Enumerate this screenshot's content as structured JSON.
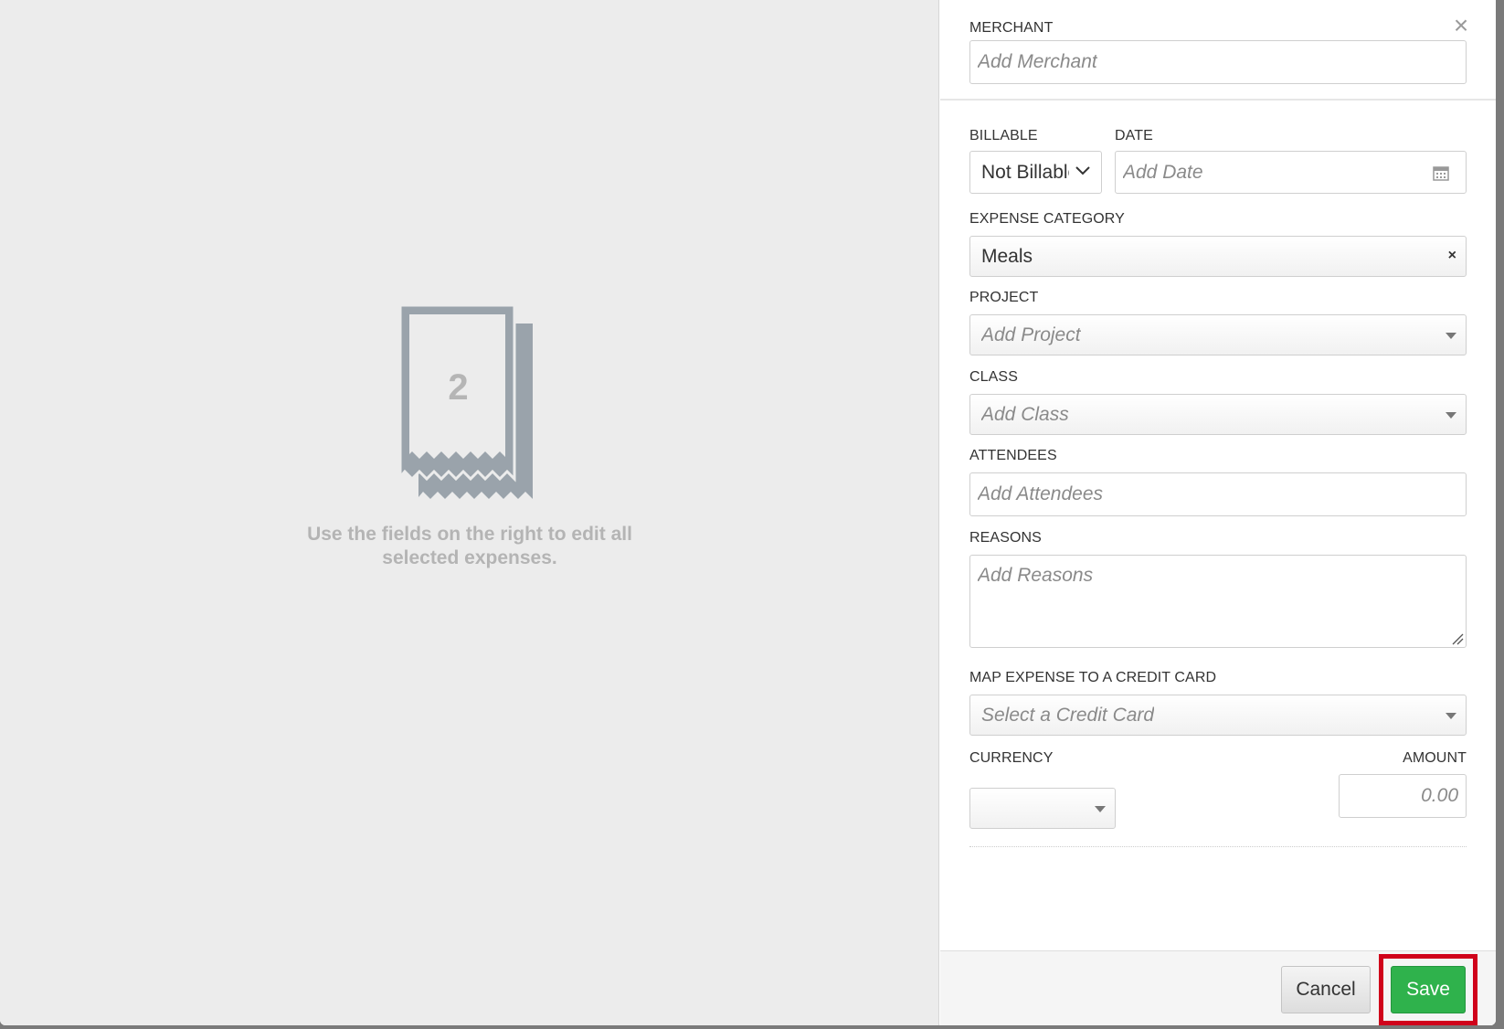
{
  "left": {
    "receipt_count": "2",
    "message": "Use the fields on the right to edit all selected expenses."
  },
  "form": {
    "merchant": {
      "label": "MERCHANT",
      "placeholder": "Add Merchant"
    },
    "billable": {
      "label": "BILLABLE",
      "value": "Not Billable"
    },
    "date": {
      "label": "DATE",
      "placeholder": "Add Date"
    },
    "expense_category": {
      "label": "EXPENSE CATEGORY",
      "value": "Meals"
    },
    "project": {
      "label": "PROJECT",
      "placeholder": "Add Project"
    },
    "class": {
      "label": "CLASS",
      "placeholder": "Add Class"
    },
    "attendees": {
      "label": "ATTENDEES",
      "placeholder": "Add Attendees"
    },
    "reasons": {
      "label": "REASONS",
      "placeholder": "Add Reasons"
    },
    "credit_card": {
      "label": "MAP EXPENSE TO A CREDIT CARD",
      "placeholder": "Select a Credit Card"
    },
    "currency": {
      "label": "CURRENCY",
      "value": ""
    },
    "amount": {
      "label": "AMOUNT",
      "placeholder": "0.00"
    }
  },
  "footer": {
    "cancel_label": "Cancel",
    "save_label": "Save"
  },
  "colors": {
    "save_green": "#2fb24c",
    "highlight_red": "#d0021b",
    "left_background": "#ececec",
    "receipt_gray": "#9aa3ab"
  }
}
